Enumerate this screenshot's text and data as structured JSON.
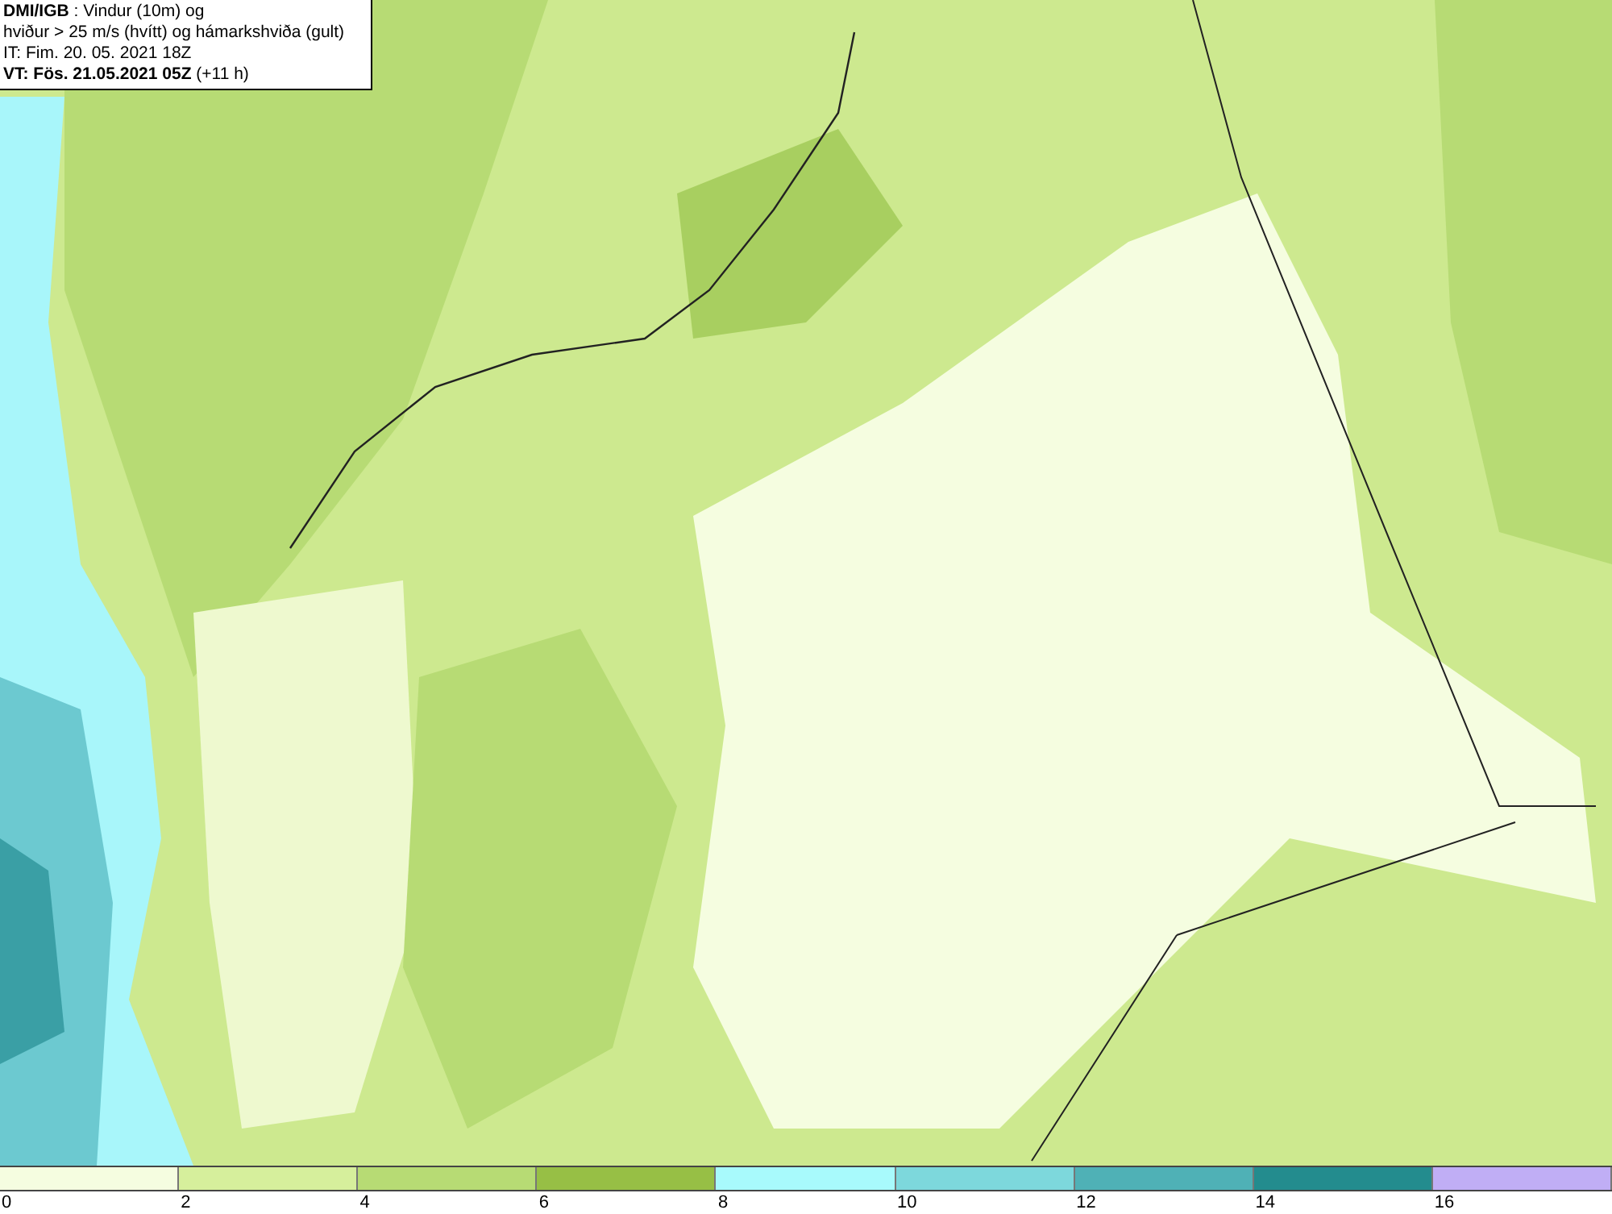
{
  "legend": {
    "lines": [
      "**DMI/IGB** : Vindur (10m) og",
      "hviður > 25 m/s (hvítt) og hámarkshviða (gult)",
      "IT: Fim. 20. 05. 2021 18Z",
      "**VT: Fös. 21.05.2021 05Z** (+11 h)"
    ]
  },
  "colorbar": {
    "bins": [
      {
        "label": "0",
        "color": "#f5fde0"
      },
      {
        "label": "2",
        "color": "#d6ef9c"
      },
      {
        "label": "4",
        "color": "#b7db74"
      },
      {
        "label": "6",
        "color": "#97bf45"
      },
      {
        "label": "8",
        "color": "#a8fafc"
      },
      {
        "label": "10",
        "color": "#7dd8dc"
      },
      {
        "label": "12",
        "color": "#4fb1b6"
      },
      {
        "label": "14",
        "color": "#238c8e"
      },
      {
        "label": "16",
        "color": "#c0aef5"
      }
    ]
  }
}
